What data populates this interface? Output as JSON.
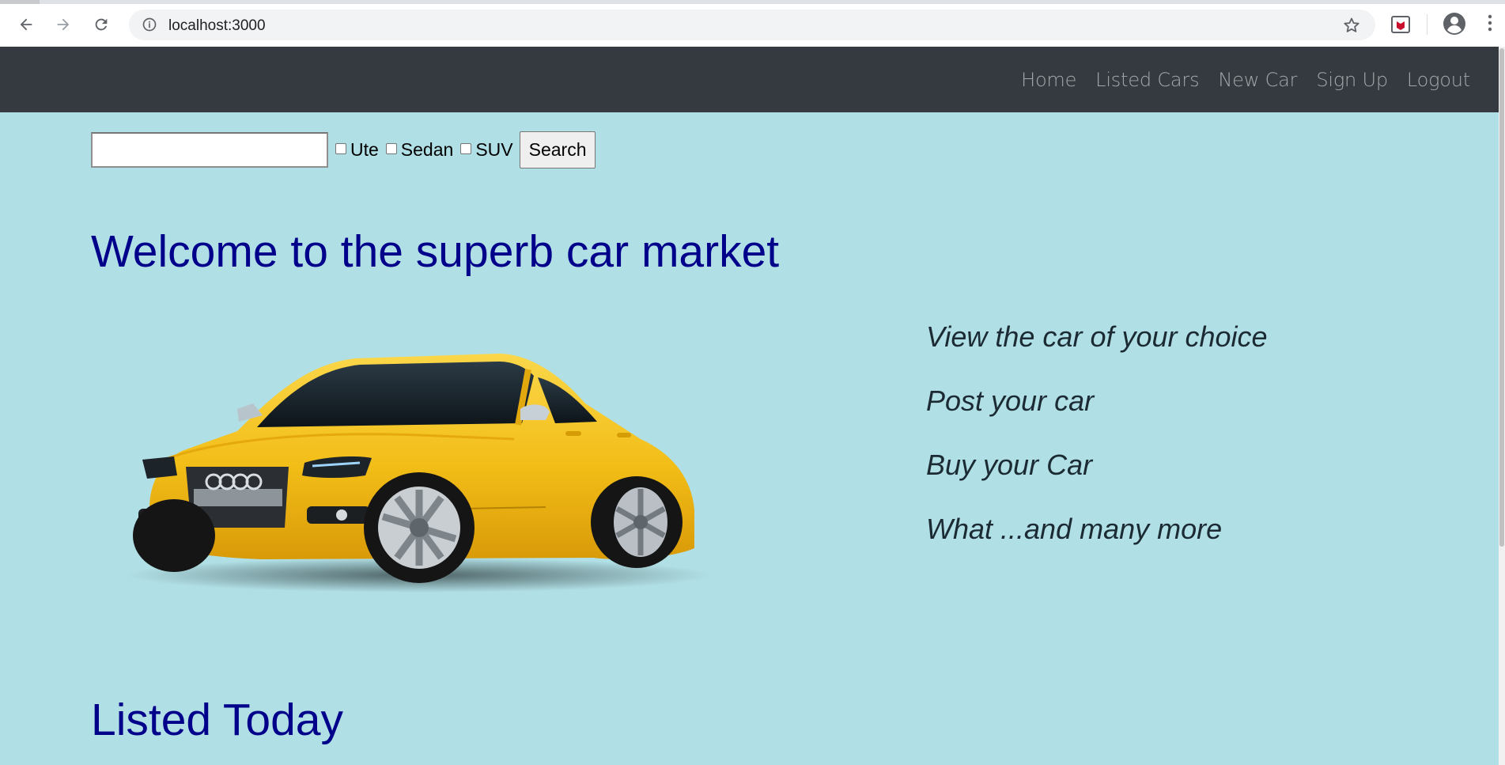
{
  "browser": {
    "url": "localhost:3000",
    "icons": [
      "back-icon",
      "forward-icon",
      "reload-icon",
      "info-icon",
      "star-icon",
      "extension-icon",
      "profile-icon",
      "menu-icon"
    ]
  },
  "navbar": {
    "links": [
      {
        "label": "Home"
      },
      {
        "label": "Listed Cars"
      },
      {
        "label": "New Car"
      },
      {
        "label": "Sign Up"
      },
      {
        "label": "Logout"
      }
    ]
  },
  "search": {
    "value": "",
    "filters": [
      {
        "label": "Ute",
        "checked": false
      },
      {
        "label": "Sedan",
        "checked": false
      },
      {
        "label": "SUV",
        "checked": false
      }
    ],
    "button_label": "Search"
  },
  "hero": {
    "title": "Welcome to the superb car market",
    "features": [
      "View the car of your choice",
      "Post your car",
      "Buy your Car",
      "What ...and many more"
    ]
  },
  "listed": {
    "title": "Listed Today"
  },
  "colors": {
    "page_background": "#b0dfe5",
    "navbar_background": "#343a40",
    "heading": "#00008b",
    "car_body": "#f4c21f"
  }
}
